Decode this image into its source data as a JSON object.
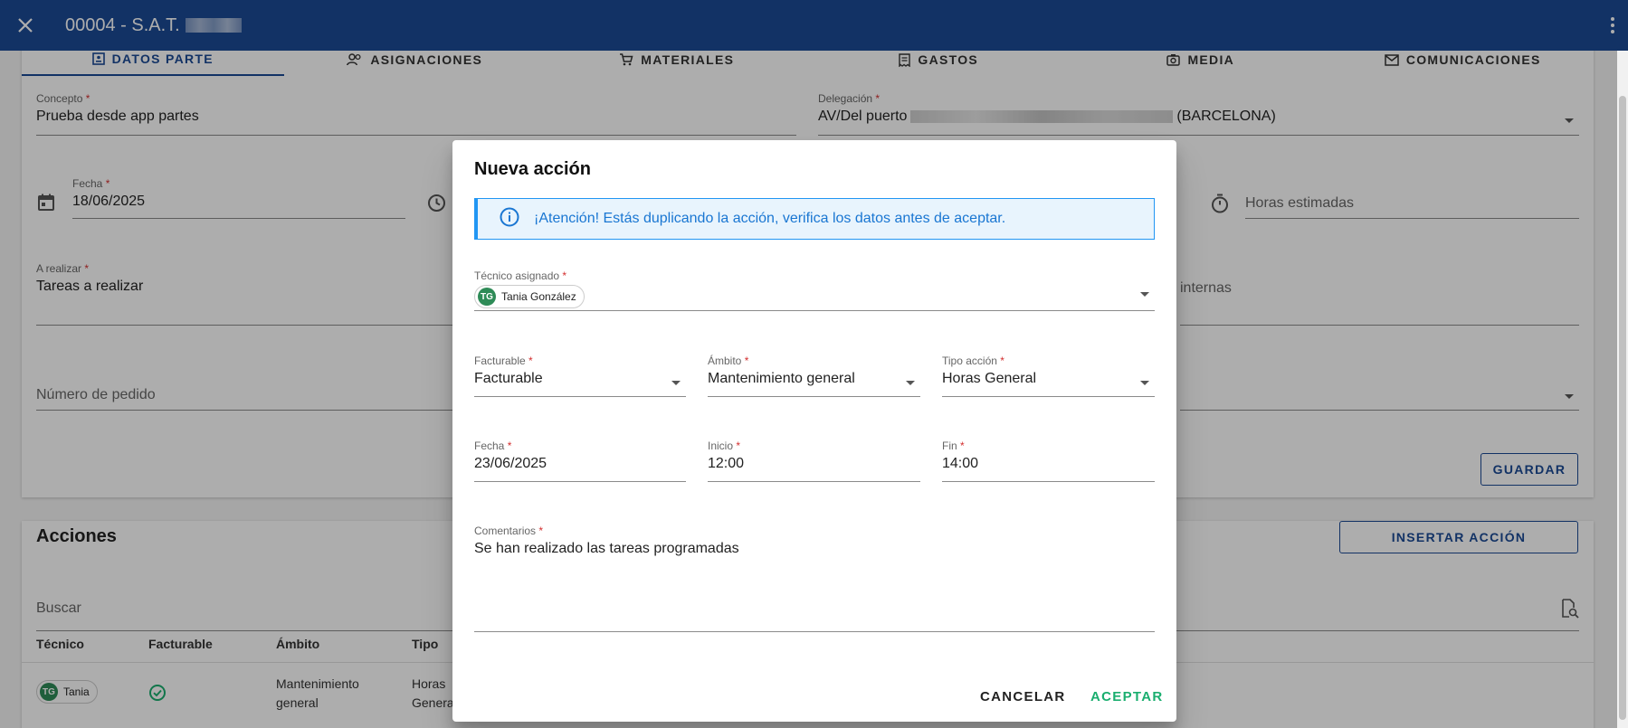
{
  "appbar": {
    "title": "00004 - S.A.T."
  },
  "tabs": [
    {
      "label": "DATOS PARTE"
    },
    {
      "label": "ASIGNACIONES"
    },
    {
      "label": "MATERIALES"
    },
    {
      "label": "GASTOS"
    },
    {
      "label": "MEDIA"
    },
    {
      "label": "COMUNICACIONES"
    }
  ],
  "form": {
    "concepto_label": "Concepto",
    "concepto_value": "Prueba desde app partes",
    "delegacion_label": "Delegación",
    "delegacion_prefix": "AV/Del puerto",
    "delegacion_suffix": "(BARCELONA)",
    "fecha_label": "Fecha",
    "fecha_value": "18/06/2025",
    "horas_placeholder": "Horas estimadas",
    "realizar_label": "A realizar",
    "realizar_value": "Tareas a realizar",
    "internas_placeholder": "internas",
    "pedido_placeholder": "Número de pedido",
    "guardar_label": "GUARDAR",
    "required_mark": "*"
  },
  "acciones": {
    "title": "Acciones",
    "insertar_label": "INSERTAR ACCIÓN",
    "buscar_placeholder": "Buscar",
    "columns": [
      "Técnico",
      "Facturable",
      "Ámbito",
      "Tipo"
    ],
    "row": {
      "tecnico_initials": "TG",
      "tecnico_name": "Tania",
      "ambito": "Mantenimiento general",
      "tipo": "Horas General"
    }
  },
  "dialog": {
    "title": "Nueva acción",
    "alert": "¡Atención! Estás duplicando la acción, verifica los datos antes de aceptar.",
    "tecnico_label": "Técnico asignado",
    "tecnico_initials": "TG",
    "tecnico_name": "Tania González",
    "facturable_label": "Facturable",
    "facturable_value": "Facturable",
    "ambito_label": "Ámbito",
    "ambito_value": "Mantenimiento general",
    "tipo_label": "Tipo acción",
    "tipo_value": "Horas General",
    "fecha_label": "Fecha",
    "fecha_value": "23/06/2025",
    "inicio_label": "Inicio",
    "inicio_value": "12:00",
    "fin_label": "Fin",
    "fin_value": "14:00",
    "comentarios_label": "Comentarios",
    "comentarios_value": "Se han realizado las tareas programadas",
    "cancel_label": "CANCELAR",
    "accept_label": "ACEPTAR"
  },
  "colors": {
    "primary": "#1b4a96",
    "accent_green": "#1aae6f",
    "info": "#2196f3",
    "required": "#d32f2f"
  }
}
